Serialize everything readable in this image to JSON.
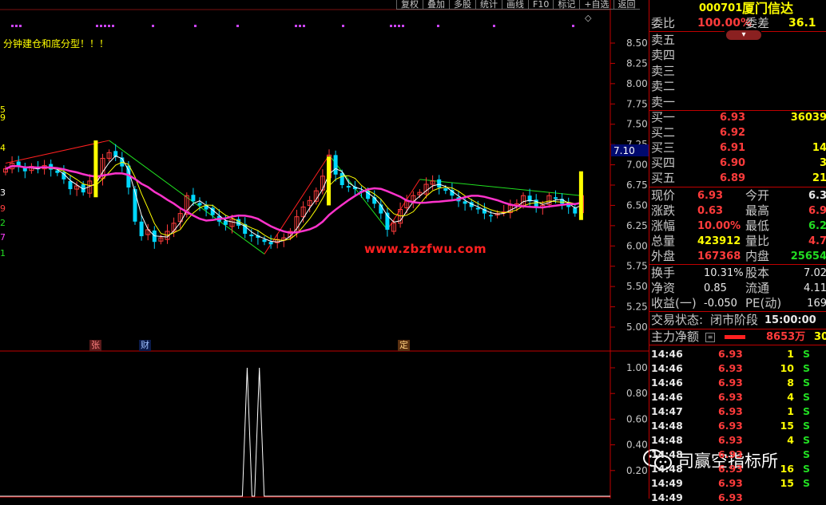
{
  "toolbar": [
    "复权",
    "叠加",
    "多股",
    "统计",
    "画线",
    "F10",
    "标记",
    "+自选",
    "返回"
  ],
  "formula_text": "分钟建仓和底分型！！！",
  "chart_markers": {
    "zhang": "张",
    "cai": "财",
    "ding": "定"
  },
  "watermark": "www.zbzfwu.com",
  "logo": {
    "text": "司赢空指标所"
  },
  "left_edge_labels": [
    "5",
    "9",
    "4",
    "3",
    "9",
    "2",
    "7",
    "1"
  ],
  "chart_data": [
    {
      "type": "candlestick",
      "title": "",
      "ylim": [
        4.9,
        8.8
      ],
      "y_ticks": [
        "8.50",
        "8.25",
        "8.00",
        "7.75",
        "7.50",
        "7.25",
        "7.00",
        "6.75",
        "6.50",
        "6.25",
        "6.00",
        "5.75",
        "5.50",
        "5.25",
        "5.00"
      ],
      "price_tag": "7.10",
      "closes": [
        6.95,
        7.02,
        6.98,
        6.92,
        6.98,
        6.95,
        6.99,
        6.94,
        6.9,
        6.82,
        6.7,
        6.74,
        6.66,
        6.8,
        6.85,
        7.08,
        7.15,
        7.1,
        6.98,
        6.72,
        6.3,
        6.12,
        6.2,
        6.05,
        6.1,
        6.18,
        6.28,
        6.4,
        6.62,
        6.55,
        6.5,
        6.45,
        6.38,
        6.3,
        6.26,
        6.33,
        6.25,
        6.15,
        6.12,
        6.1,
        6.05,
        6.02,
        6.08,
        6.1,
        6.18,
        6.36,
        6.48,
        6.56,
        6.68,
        6.86,
        7.12,
        6.88,
        6.75,
        6.72,
        6.7,
        6.68,
        6.58,
        6.52,
        6.4,
        6.2,
        6.28,
        6.45,
        6.56,
        6.62,
        6.66,
        6.76,
        6.8,
        6.72,
        6.68,
        6.62,
        6.55,
        6.52,
        6.48,
        6.45,
        6.4,
        6.38,
        6.4,
        6.42,
        6.5,
        6.52,
        6.62,
        6.55,
        6.48,
        6.5,
        6.62,
        6.58,
        6.52,
        6.48,
        6.4,
        6.62
      ]
    },
    {
      "type": "line",
      "title": "",
      "ylim": [
        0,
        1.05
      ],
      "y_ticks": [
        "1.00",
        "0.80",
        "0.60",
        "0.40",
        "0.20"
      ],
      "signal_positions": [
        0.405,
        0.425
      ]
    }
  ],
  "panel": {
    "code": "000701",
    "name": "厦门信达",
    "weibi_label": "委比",
    "weibi_value": "100.00%",
    "weicha_label": "委差",
    "weicha_value": "36.1",
    "asks": [
      {
        "label": "卖五"
      },
      {
        "label": "卖四"
      },
      {
        "label": "卖三"
      },
      {
        "label": "卖二"
      },
      {
        "label": "卖一"
      }
    ],
    "bids": [
      {
        "label": "买一",
        "price": "6.93",
        "vol": "36039"
      },
      {
        "label": "买二",
        "price": "6.92",
        "vol": ""
      },
      {
        "label": "买三",
        "price": "6.91",
        "vol": "14"
      },
      {
        "label": "买四",
        "price": "6.90",
        "vol": "3"
      },
      {
        "label": "买五",
        "price": "6.89",
        "vol": "21"
      }
    ],
    "stats": [
      {
        "l1": "现价",
        "v1": "6.93",
        "c1": "red",
        "l2": "今开",
        "v2": "6.3",
        "c2": "white"
      },
      {
        "l1": "涨跌",
        "v1": "0.63",
        "c1": "red",
        "l2": "最高",
        "v2": "6.9",
        "c2": "red"
      },
      {
        "l1": "涨幅",
        "v1": "10.00%",
        "c1": "red",
        "l2": "最低",
        "v2": "6.2",
        "c2": "green"
      },
      {
        "l1": "总量",
        "v1": "423912",
        "c1": "yellow",
        "l2": "量比",
        "v2": "4.7",
        "c2": "red"
      },
      {
        "l1": "外盘",
        "v1": "167368",
        "c1": "red",
        "l2": "内盘",
        "v2": "25654",
        "c2": "green"
      }
    ],
    "stats2": [
      {
        "l1": "换手",
        "v1": "10.31%",
        "l2": "股本",
        "v2": "7.02"
      },
      {
        "l1": "净资",
        "v1": "0.85",
        "l2": "流通",
        "v2": "4.11"
      },
      {
        "l1": "收益(一)",
        "v1": "-0.050",
        "l2": "PE(动)",
        "v2": "169"
      }
    ],
    "status_label": "交易状态:",
    "status_value": "闭市阶段",
    "status_time": "15:00:00",
    "main_label": "主力净额",
    "main_value": "8653万",
    "main_extra": "30",
    "ticks": [
      {
        "t": "14:46",
        "p": "6.93",
        "v": "1",
        "s": "S"
      },
      {
        "t": "14:46",
        "p": "6.93",
        "v": "10",
        "s": "S"
      },
      {
        "t": "14:46",
        "p": "6.93",
        "v": "8",
        "s": "S"
      },
      {
        "t": "14:46",
        "p": "6.93",
        "v": "4",
        "s": "S"
      },
      {
        "t": "14:47",
        "p": "6.93",
        "v": "1",
        "s": "S"
      },
      {
        "t": "14:48",
        "p": "6.93",
        "v": "15",
        "s": "S"
      },
      {
        "t": "14:48",
        "p": "6.93",
        "v": "4",
        "s": "S"
      },
      {
        "t": "14:48",
        "p": "6.93",
        "v": "",
        "s": "S"
      },
      {
        "t": "14:48",
        "p": "6.93",
        "v": "16",
        "s": "S"
      },
      {
        "t": "14:49",
        "p": "6.93",
        "v": "15",
        "s": "S"
      },
      {
        "t": "14:49",
        "p": "6.93",
        "v": "",
        "s": ""
      }
    ]
  }
}
